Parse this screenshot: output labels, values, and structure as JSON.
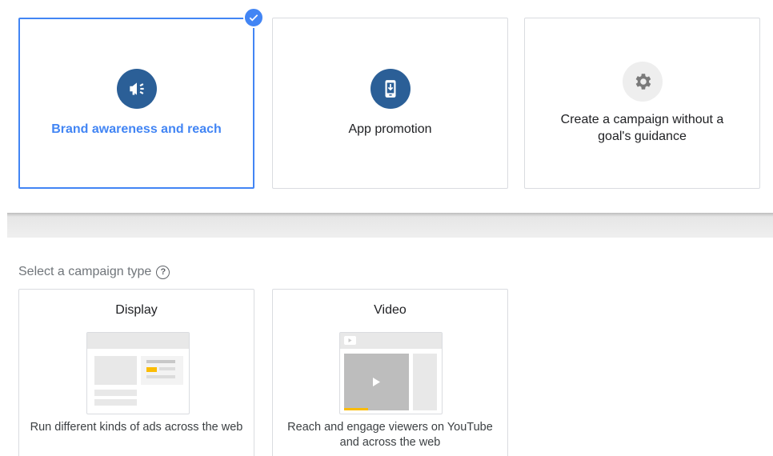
{
  "goals": [
    {
      "label": "Brand awareness and reach",
      "icon": "megaphone-icon",
      "selected": true
    },
    {
      "label": "App promotion",
      "icon": "phone-download-icon",
      "selected": false
    },
    {
      "label": "Create a campaign without a goal's guidance",
      "icon": "gear-icon",
      "selected": false
    }
  ],
  "campaign_type": {
    "title": "Select a campaign type",
    "help_glyph": "?",
    "types": [
      {
        "title": "Display",
        "description": "Run different kinds of ads across the web"
      },
      {
        "title": "Video",
        "description": "Reach and engage viewers on YouTube and across the web"
      }
    ]
  },
  "colors": {
    "accent": "#4285f4",
    "icon_bg": "#2b5f97",
    "highlight": "#fbbc04"
  }
}
